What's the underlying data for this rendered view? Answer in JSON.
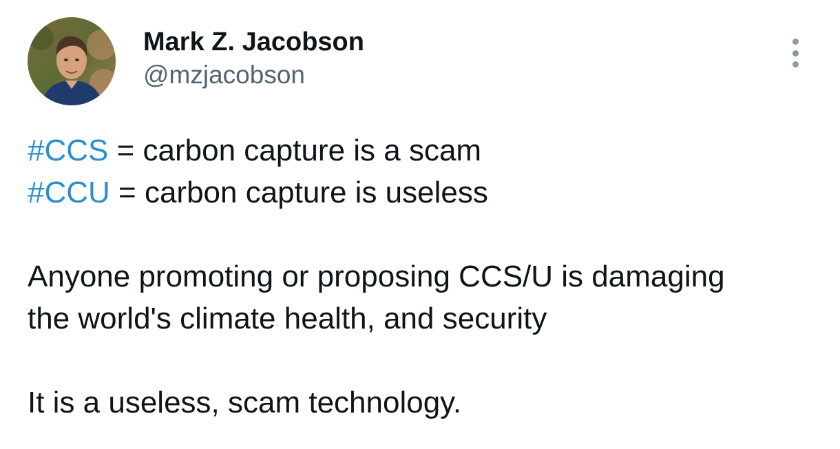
{
  "author": {
    "name": "Mark Z. Jacobson",
    "handle": "@mzjacobson"
  },
  "tweet": {
    "line1_tag": "#CCS",
    "line1_rest": " = carbon capture is a scam",
    "line2_tag": "#CCU",
    "line2_rest": " = carbon capture is useless",
    "para2_line1": "Anyone promoting or proposing CCS/U is damaging",
    "para2_line2": "the world's climate health, and security",
    "para3": "It is a useless, scam technology."
  },
  "icons": {
    "more": "more-vertical-icon"
  },
  "colors": {
    "hashtag": "#2a8fcf",
    "handle": "#536471",
    "text": "#0f1419"
  }
}
